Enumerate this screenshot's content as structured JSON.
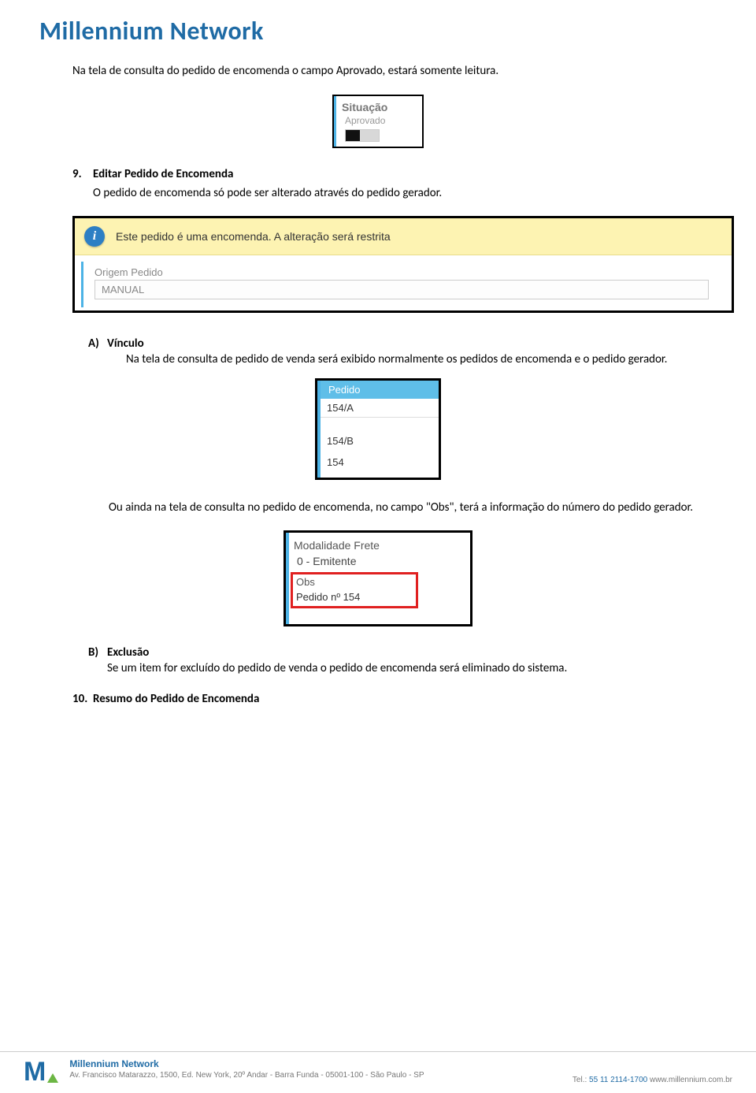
{
  "header": {
    "brand": "Millennium Network"
  },
  "p1": "Na tela de consulta do pedido de encomenda o campo Aprovado, estará somente leitura.",
  "shot1": {
    "label": "Situação",
    "value": "Aprovado"
  },
  "sec9": {
    "num": "9.",
    "title": "Editar Pedido de Encomenda",
    "text": "O pedido de encomenda só pode ser alterado através do pedido gerador."
  },
  "shot2": {
    "toast": "Este pedido é uma encomenda. A alteração será restrita",
    "field_label": "Origem Pedido",
    "field_value": "MANUAL"
  },
  "secA": {
    "letter": "A)",
    "title": "Vínculo",
    "text": "Na tela de consulta de pedido de venda será exibido normalmente os pedidos de encomenda e o pedido gerador."
  },
  "shot3": {
    "header": "Pedido",
    "rows": [
      "154/A",
      "154/B",
      "154"
    ]
  },
  "pObs": "Ou ainda na tela de consulta no pedido de encomenda, no campo \"Obs\", terá a informação do número do pedido gerador.",
  "shot4": {
    "frete_label": "Modalidade Frete",
    "frete_value": "0 - Emitente",
    "obs_label": "Obs",
    "obs_value": "Pedido nº 154"
  },
  "secB": {
    "letter": "B)",
    "title": "Exclusão",
    "text": "Se um item for excluído do pedido de venda o pedido de encomenda será eliminado do sistema."
  },
  "sec10": {
    "num": "10.",
    "title": "Resumo do Pedido de Encomenda"
  },
  "footer": {
    "name": "Millennium Network",
    "addr": "Av. Francisco Matarazzo, 1500, Ed. New York, 20º Andar  - Barra Funda - 05001-100 - São Paulo - SP",
    "tel_label": "Tel.:",
    "tel": "55 11 2114-1700",
    "url": "www.millennium.com.br"
  }
}
